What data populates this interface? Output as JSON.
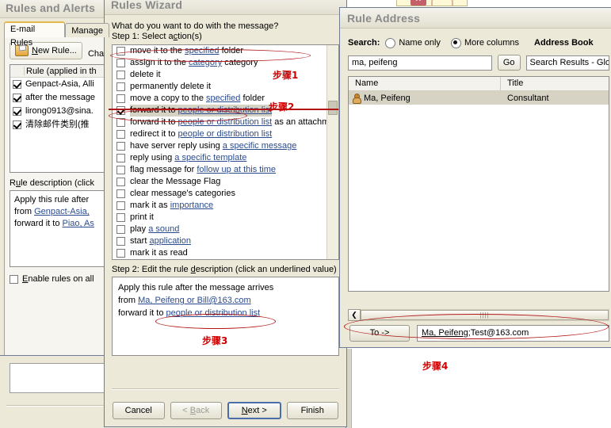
{
  "rules_and_alerts": {
    "title": "Rules and Alerts",
    "tabs": [
      {
        "label": "E-mail Rules",
        "active": true
      },
      {
        "label": "Manage",
        "active": false
      }
    ],
    "toolbar": {
      "new_rule_label": "New Rule...",
      "new_rule_icon": "folder-icon",
      "change_label": "Cha"
    },
    "rules_list": {
      "header": "Rule (applied in th",
      "rows": [
        {
          "checked": true,
          "label": "Genpact-Asia, Alli"
        },
        {
          "checked": true,
          "label": "after the message"
        },
        {
          "checked": true,
          "label": "lirong0913@sina."
        },
        {
          "checked": true,
          "label": "清除邮件类别(推"
        }
      ]
    },
    "description": {
      "label": "Rule description (click ",
      "lines": [
        {
          "text": "Apply this rule after ",
          "link": ""
        },
        {
          "text": "from ",
          "link": "Genpact-Asia, "
        },
        {
          "text": "forward it to ",
          "link": "Piao, As"
        }
      ]
    },
    "enable_all": {
      "label": "Enable rules on all ",
      "checked": false
    }
  },
  "rules_wizard": {
    "title": "Rules Wizard",
    "question": "What do you want to do with the message?",
    "step1_label": "Step 1: Select action(s)",
    "actions": [
      {
        "checked": false,
        "parts": [
          {
            "t": "move it to the ",
            "l": false
          },
          {
            "t": "specified",
            "l": true
          },
          {
            "t": " folder",
            "l": false
          }
        ]
      },
      {
        "checked": false,
        "parts": [
          {
            "t": "assign it to the ",
            "l": false
          },
          {
            "t": "category",
            "l": true
          },
          {
            "t": " category",
            "l": false
          }
        ]
      },
      {
        "checked": false,
        "parts": [
          {
            "t": "delete it",
            "l": false
          }
        ]
      },
      {
        "checked": false,
        "parts": [
          {
            "t": "permanently delete it",
            "l": false
          }
        ]
      },
      {
        "checked": false,
        "parts": [
          {
            "t": "move a copy to the ",
            "l": false
          },
          {
            "t": "specified",
            "l": true
          },
          {
            "t": " folder",
            "l": false
          }
        ]
      },
      {
        "checked": true,
        "selected": true,
        "parts": [
          {
            "t": "forward it to ",
            "l": false
          },
          {
            "t": "people or distribution list",
            "l": true
          }
        ]
      },
      {
        "checked": false,
        "parts": [
          {
            "t": "forward it to ",
            "l": false
          },
          {
            "t": "people or distribution list",
            "l": true
          },
          {
            "t": " as an attachment",
            "l": false
          }
        ]
      },
      {
        "checked": false,
        "parts": [
          {
            "t": "redirect it to ",
            "l": false
          },
          {
            "t": "people or distribution list",
            "l": true
          }
        ]
      },
      {
        "checked": false,
        "parts": [
          {
            "t": "have server reply using ",
            "l": false
          },
          {
            "t": "a specific message",
            "l": true
          }
        ]
      },
      {
        "checked": false,
        "parts": [
          {
            "t": "reply using ",
            "l": false
          },
          {
            "t": "a specific template",
            "l": true
          }
        ]
      },
      {
        "checked": false,
        "parts": [
          {
            "t": "flag message for ",
            "l": false
          },
          {
            "t": "follow up at this time",
            "l": true
          }
        ]
      },
      {
        "checked": false,
        "parts": [
          {
            "t": "clear the Message Flag",
            "l": false
          }
        ]
      },
      {
        "checked": false,
        "parts": [
          {
            "t": "clear message's categories",
            "l": false
          }
        ]
      },
      {
        "checked": false,
        "parts": [
          {
            "t": "mark it as ",
            "l": false
          },
          {
            "t": "importance",
            "l": true
          }
        ]
      },
      {
        "checked": false,
        "parts": [
          {
            "t": "print it",
            "l": false
          }
        ]
      },
      {
        "checked": false,
        "parts": [
          {
            "t": "play ",
            "l": false
          },
          {
            "t": "a sound",
            "l": true
          }
        ]
      },
      {
        "checked": false,
        "parts": [
          {
            "t": "start ",
            "l": false
          },
          {
            "t": "application",
            "l": true
          }
        ]
      },
      {
        "checked": false,
        "parts": [
          {
            "t": "mark it as read",
            "l": false
          }
        ]
      }
    ],
    "step2_label": "Step 2: Edit the rule description (click an underlined value)",
    "rule_description": [
      [
        {
          "t": "Apply this rule after the message arrives",
          "l": false
        }
      ],
      [
        {
          "t": "from ",
          "l": false
        },
        {
          "t": "Ma, Peifeng or Bill@163.com",
          "l": true
        }
      ],
      [
        {
          "t": "forward it to ",
          "l": false
        },
        {
          "t": "people or distribution list",
          "l": true
        }
      ]
    ],
    "buttons": [
      {
        "label": "Cancel",
        "state": "normal"
      },
      {
        "label": "< Back",
        "state": "disabled"
      },
      {
        "label": "Next >",
        "state": "default"
      },
      {
        "label": "Finish",
        "state": "normal"
      }
    ]
  },
  "rule_address": {
    "title": "Rule Address",
    "search_label": "Search:",
    "radios": [
      {
        "label": "Name only",
        "selected": false
      },
      {
        "label": "More columns",
        "selected": true
      }
    ],
    "address_book_label": "Address Book",
    "search_value": "ma, peifeng",
    "go_button": "Go",
    "address_book_value": "Search Results - Glo",
    "columns": [
      "Name",
      "Title"
    ],
    "rows": [
      {
        "name": "Ma, Peifeng",
        "title": "Consultant",
        "icon": "person-icon",
        "selected": true
      }
    ],
    "to_button": "To ->",
    "to_value_link": "Ma, Peifeng",
    "to_value_rest": ";Test@163.com"
  },
  "annotations": [
    {
      "id": "step1",
      "text": "步骤1"
    },
    {
      "id": "step2",
      "text": "步骤2"
    },
    {
      "id": "step3",
      "text": "步骤3"
    },
    {
      "id": "step4",
      "text": "步骤4"
    }
  ],
  "colors": {
    "annotation_red": "#cc0000",
    "highlight_outline": "#b11616",
    "window_face": "#ece9d8",
    "link_blue": "#2a4b8d",
    "selection": "#d6d2c4"
  }
}
